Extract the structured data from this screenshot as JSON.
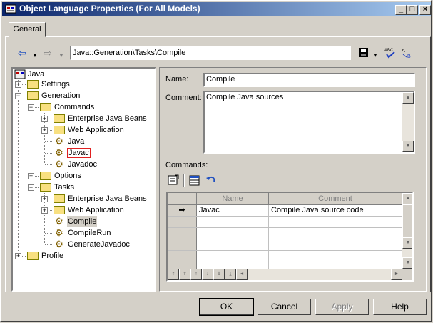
{
  "window": {
    "title": "Object Language Properties (For All Models)"
  },
  "tabs": [
    {
      "label": "General"
    }
  ],
  "path": "Java::Generation\\Tasks\\Compile",
  "tree": {
    "root": "Java",
    "settings": "Settings",
    "generation": "Generation",
    "commands": "Commands",
    "ejb1": "Enterprise Java Beans",
    "webapp1": "Web Application",
    "java": "Java",
    "javac": "Javac",
    "javadoc": "Javadoc",
    "options": "Options",
    "tasks": "Tasks",
    "ejb2": "Enterprise Java Beans",
    "webapp2": "Web Application",
    "compile": "Compile",
    "compilerun": "CompileRun",
    "generatejavadoc": "GenerateJavadoc",
    "profile": "Profile"
  },
  "form": {
    "name_label": "Name:",
    "name_value": "Compile",
    "comment_label": "Comment:",
    "comment_value": "Compile Java sources",
    "commands_label": "Commands:"
  },
  "grid": {
    "col_name": "Name",
    "col_comment": "Comment",
    "rows": [
      {
        "name": "Javac",
        "comment": "Compile Java source code"
      }
    ]
  },
  "buttons": {
    "ok": "OK",
    "cancel": "Cancel",
    "apply": "Apply",
    "help": "Help"
  },
  "icons": {
    "back": "arrow-left-icon",
    "forward": "arrow-right-icon",
    "save": "floppy-icon",
    "spell": "spellcheck-icon",
    "findreplace": "find-replace-icon"
  }
}
